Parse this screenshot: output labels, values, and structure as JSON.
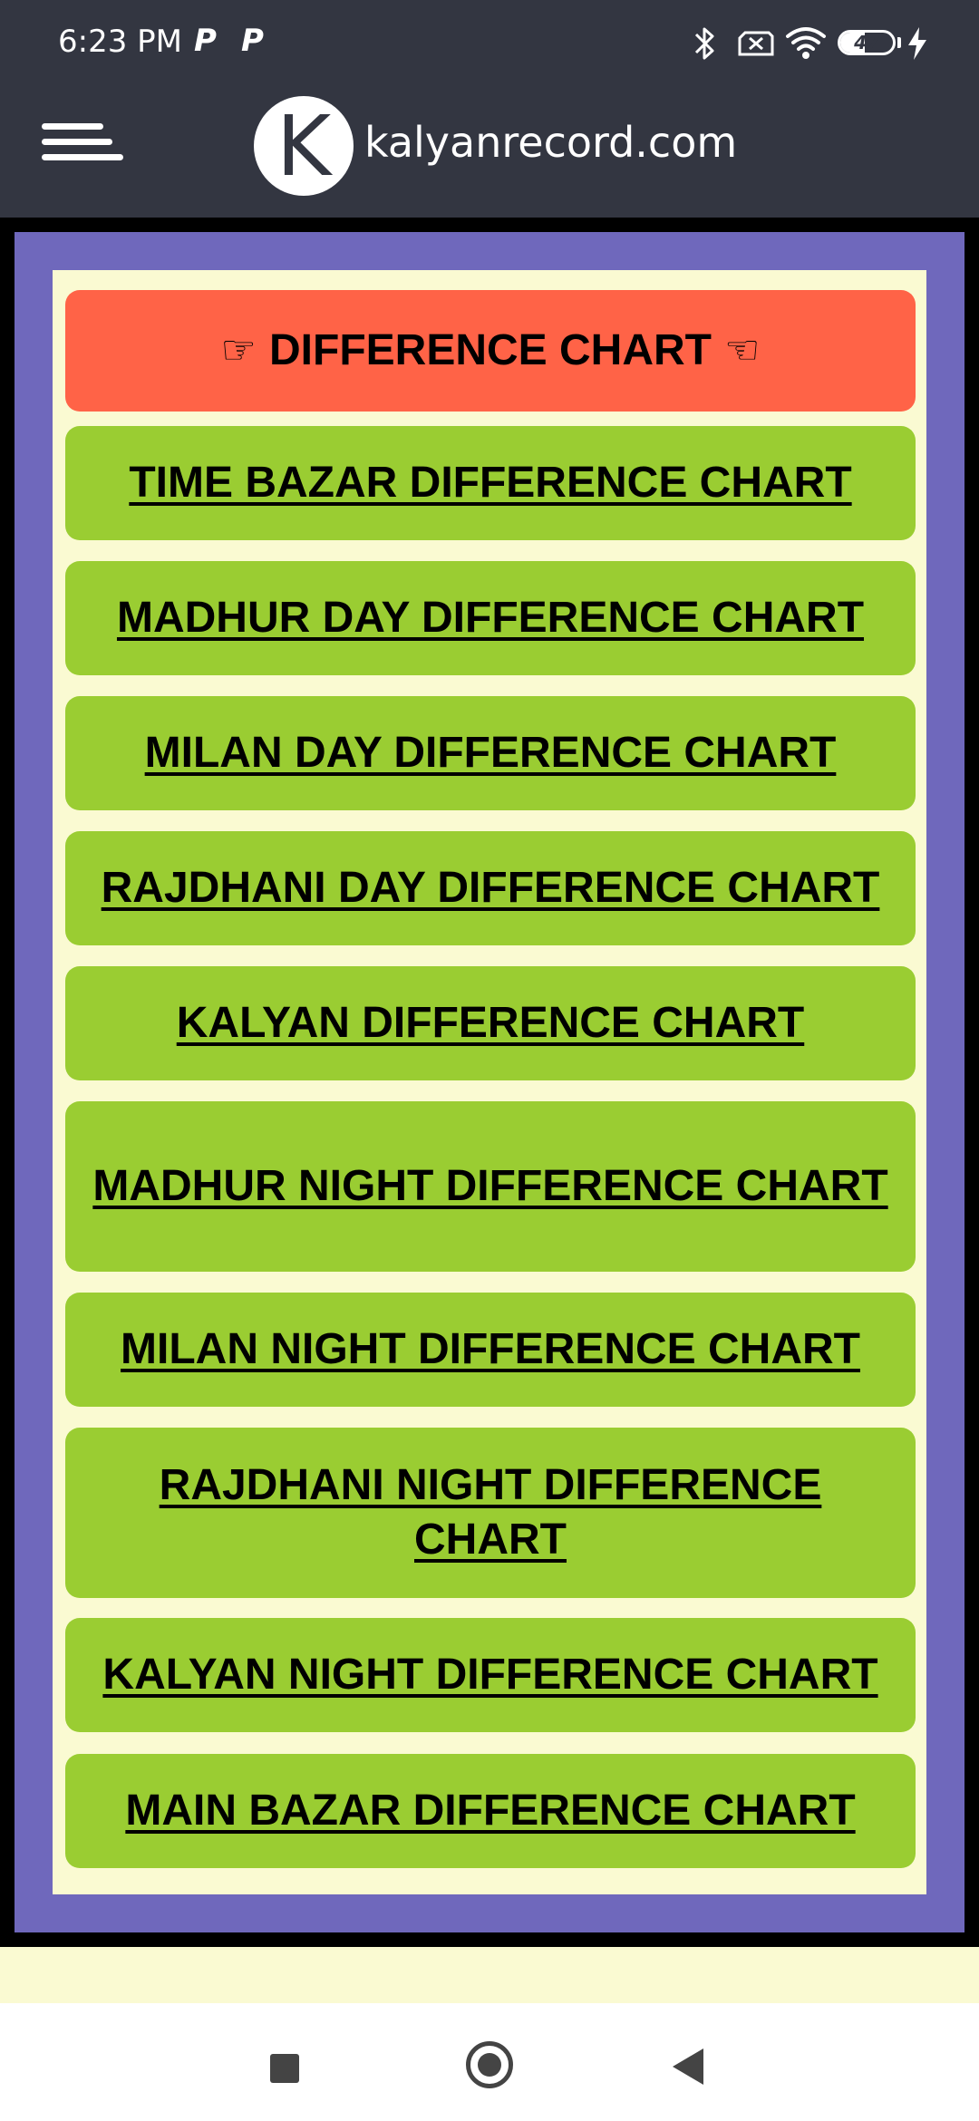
{
  "status_bar": {
    "time": "6:23 PM",
    "notification_icons": [
      "P",
      "P"
    ],
    "battery_level": "47",
    "icons": [
      "bluetooth-icon",
      "no-sim-icon",
      "wifi-icon",
      "battery-icon",
      "charging-icon"
    ]
  },
  "header": {
    "logo_letter": "K",
    "site_name": "kalyanrecord.com",
    "menu_icon": "hamburger-menu-icon"
  },
  "main": {
    "title_card": {
      "label": "DIFFERENCE CHART",
      "left_hand": "☞",
      "right_hand": "☜"
    },
    "links": [
      {
        "label": "TIME BAZAR DIFFERENCE CHART"
      },
      {
        "label": "MADHUR DAY DIFFERENCE CHART"
      },
      {
        "label": "MILAN DAY DIFFERENCE CHART"
      },
      {
        "label": "RAJDHANI DAY DIFFERENCE CHART"
      },
      {
        "label": "KALYAN DIFFERENCE CHART"
      },
      {
        "label": "MADHUR NIGHT DIFFERENCE CHART"
      },
      {
        "label": "MILAN NIGHT DIFFERENCE CHART"
      },
      {
        "label": "RAJDHANI NIGHT DIFFERENCE CHART"
      },
      {
        "label": "KALYAN NIGHT DIFFERENCE CHART"
      },
      {
        "label": "MAIN BAZAR DIFFERENCE CHART"
      }
    ]
  },
  "colors": {
    "topbar": "#333641",
    "frame": "#000000",
    "border": "#6f68bc",
    "panel": "#fafad2",
    "title_card": "#ff6347",
    "link_card": "#9acd32"
  },
  "nav_bar": {
    "icons": [
      "recent-apps-icon",
      "home-icon",
      "back-icon"
    ]
  }
}
